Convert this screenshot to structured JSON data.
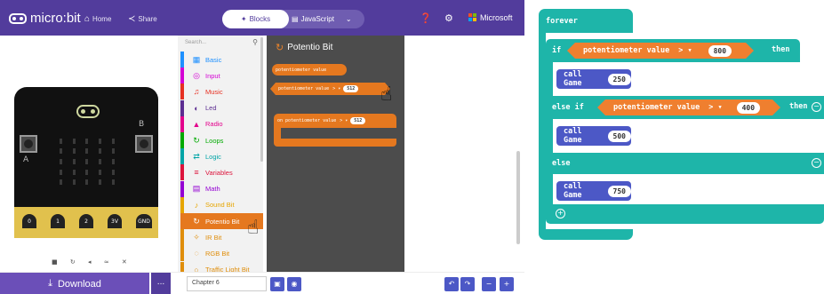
{
  "topbar": {
    "brand": "micro:bit",
    "home_label": "Home",
    "share_label": "Share",
    "blocks_tab": "Blocks",
    "javascript_tab": "JavaScript",
    "microsoft_label": "Microsoft",
    "colors": {
      "bar": "#523c9c",
      "toggle": "#6f5db1"
    }
  },
  "simulator": {
    "pin_labels": [
      "0",
      "1",
      "2",
      "3V",
      "GND"
    ],
    "button_a_label": "A",
    "button_b_label": "B",
    "controls": [
      "stop-icon",
      "restart-icon",
      "mute-icon",
      "slow-mo-icon",
      "fullscreen-icon"
    ],
    "board_color": "#111111",
    "edge_color": "#e1c14d"
  },
  "toolbox": {
    "search_placeholder": "Search...",
    "categories": [
      {
        "label": "Basic",
        "icon": "grid-icon",
        "color": "#1e90ff",
        "glyph": "▦"
      },
      {
        "label": "Input",
        "icon": "target-icon",
        "color": "#d400d4",
        "glyph": "◎"
      },
      {
        "label": "Music",
        "icon": "headphones-icon",
        "color": "#e63022",
        "glyph": "♫"
      },
      {
        "label": "Led",
        "icon": "toggle-icon",
        "color": "#5c2d91",
        "glyph": "◐"
      },
      {
        "label": "Radio",
        "icon": "signal-icon",
        "color": "#e3008c",
        "glyph": "▲"
      },
      {
        "label": "Loops",
        "icon": "loop-icon",
        "color": "#00aa00",
        "glyph": "↻"
      },
      {
        "label": "Logic",
        "icon": "shuffle-icon",
        "color": "#00a4a6",
        "glyph": "⇄"
      },
      {
        "label": "Variables",
        "icon": "list-icon",
        "color": "#dc143c",
        "glyph": "≡"
      },
      {
        "label": "Math",
        "icon": "calculator-icon",
        "color": "#9400d3",
        "glyph": "▤"
      },
      {
        "label": "Sound Bit",
        "icon": "mic-icon",
        "color": "#e6a500",
        "glyph": "♪"
      },
      {
        "label": "Potentio Bit",
        "icon": "loop-icon",
        "color": "#e5781f",
        "glyph": "↻"
      },
      {
        "label": "IR Bit",
        "icon": "sun-icon",
        "color": "#e08e0b",
        "glyph": "✧"
      },
      {
        "label": "RGB Bit",
        "icon": "circle-icon",
        "color": "#e08e0b",
        "glyph": "◌"
      },
      {
        "label": "Traffic Light Bit",
        "icon": "light-icon",
        "color": "#e08e0b",
        "glyph": "○"
      }
    ],
    "selected_index": 10
  },
  "flyout": {
    "title": "Potentio Bit",
    "block_value": "potentiometer value",
    "block_compare": "potentiometer value",
    "block_compare_op": ">",
    "block_compare_num": "512",
    "block_event": "on potentiometer value",
    "block_event_op": ">",
    "block_event_num": "512",
    "block_color": "#e5781f"
  },
  "bottombar": {
    "download_label": "Download",
    "more_label": "...",
    "project_name": "Chapter 6"
  },
  "code": {
    "forever_label": "forever",
    "if_label": "if",
    "else_if_label": "else if",
    "else_label": "else",
    "then_label": "then",
    "call_label": "call Game",
    "sensor_label": "potentiometer value",
    "op": ">",
    "dropdown": "▾",
    "threshold1": "800",
    "threshold2": "400",
    "game1": "250",
    "game2": "500",
    "game3": "750",
    "colors": {
      "loop": "#1eb5a9",
      "call": "#4c58c6",
      "sensor": "#ef7f2f"
    }
  }
}
